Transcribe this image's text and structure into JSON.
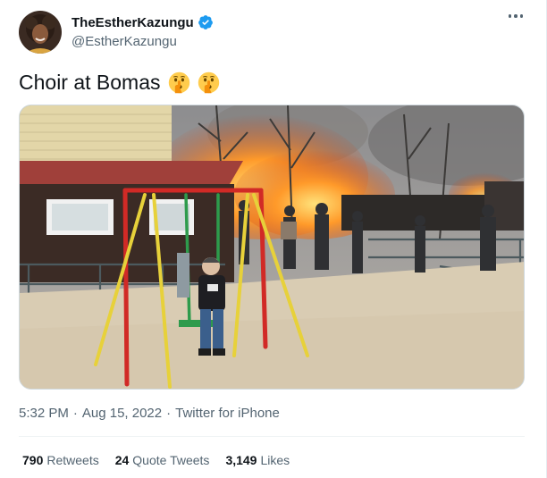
{
  "author": {
    "display_name": "TheEstherKazungu",
    "handle": "@EstherKazungu",
    "verified": true
  },
  "tweet": {
    "text": "Choir at Bomas",
    "emojis": [
      "shushing-face-emoji",
      "shushing-face-emoji"
    ]
  },
  "meta": {
    "time": "5:32 PM",
    "separator": "·",
    "date": "Aug 15, 2022",
    "source": "Twitter for iPhone"
  },
  "stats": [
    {
      "value": "790",
      "label": "Retweets"
    },
    {
      "value": "24",
      "label": "Quote Tweets"
    },
    {
      "value": "3,149",
      "label": "Likes"
    }
  ],
  "colors": {
    "verified_blue": "#1d9bf0",
    "secondary_text": "#536471",
    "primary_text": "#0f1419"
  },
  "icons": {
    "more": "more-horizontal-icon",
    "verified": "verified-badge-icon"
  }
}
